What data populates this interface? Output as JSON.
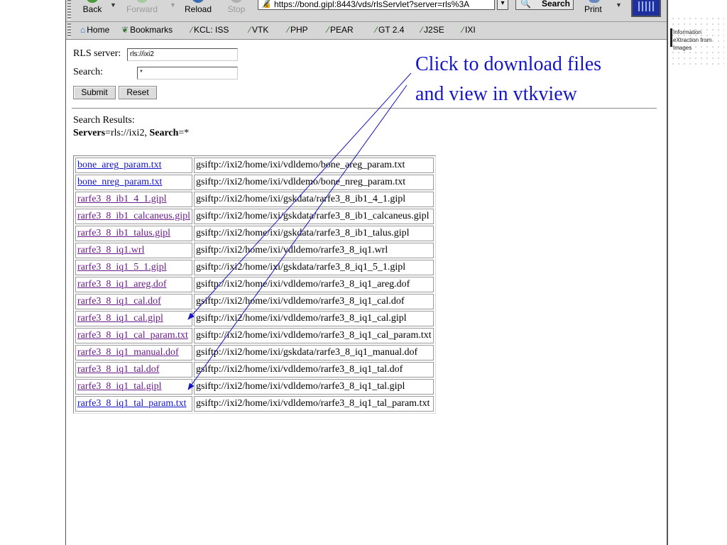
{
  "toolbar": {
    "back": "Back",
    "forward": "Forward",
    "reload": "Reload",
    "stop": "Stop",
    "url": "https://bond.gipl:8443/vds/rlsServlet?server=rls%3A",
    "search": "Search",
    "print": "Print"
  },
  "personal_toolbar": {
    "items": [
      "Home",
      "Bookmarks",
      "KCL: ISS",
      "VTK",
      "PHP",
      "PEAR",
      "GT 2.4",
      "J2SE",
      "IXI"
    ]
  },
  "form": {
    "server_label": "RLS server:",
    "server_value": "rls://ixi2",
    "search_label": "Search:",
    "search_value": "*",
    "submit": "Submit",
    "reset": "Reset"
  },
  "results": {
    "heading": "Search Results:",
    "servers_key": "Servers",
    "servers_value": "=rls://ixi2, ",
    "search_key": "Search",
    "search_value": "=*",
    "rows": [
      {
        "name": "bone_areg_param.txt",
        "path": "gsiftp://ixi2/home/ixi/vdldemo/bone_areg_param.txt",
        "visited": false
      },
      {
        "name": "bone_nreg_param.txt",
        "path": "gsiftp://ixi2/home/ixi/vdldemo/bone_nreg_param.txt",
        "visited": false
      },
      {
        "name": "rarfe3_8_ib1_4_1.gipl",
        "path": "gsiftp://ixi2/home/ixi/gskdata/rarfe3_8_ib1_4_1.gipl",
        "visited": true
      },
      {
        "name": "rarfe3_8_ib1_calcaneus.gipl",
        "path": "gsiftp://ixi2/home/ixi/gskdata/rarfe3_8_ib1_calcaneus.gipl",
        "visited": true
      },
      {
        "name": "rarfe3_8_ib1_talus.gipl",
        "path": "gsiftp://ixi2/home/ixi/gskdata/rarfe3_8_ib1_talus.gipl",
        "visited": true
      },
      {
        "name": "rarfe3_8_iq1.wrl",
        "path": "gsiftp://ixi2/home/ixi/vdldemo/rarfe3_8_iq1.wrl",
        "visited": true
      },
      {
        "name": "rarfe3_8_iq1_5_1.gipl",
        "path": "gsiftp://ixi2/home/ixi/gskdata/rarfe3_8_iq1_5_1.gipl",
        "visited": true
      },
      {
        "name": "rarfe3_8_iq1_areg.dof",
        "path": "gsiftp://ixi2/home/ixi/vdldemo/rarfe3_8_iq1_areg.dof",
        "visited": true
      },
      {
        "name": "rarfe3_8_iq1_cal.dof",
        "path": "gsiftp://ixi2/home/ixi/vdldemo/rarfe3_8_iq1_cal.dof",
        "visited": true
      },
      {
        "name": "rarfe3_8_iq1_cal.gipl",
        "path": "gsiftp://ixi2/home/ixi/vdldemo/rarfe3_8_iq1_cal.gipl",
        "visited": true
      },
      {
        "name": "rarfe3_8_iq1_cal_param.txt",
        "path": "gsiftp://ixi2/home/ixi/vdldemo/rarfe3_8_iq1_cal_param.txt",
        "visited": true
      },
      {
        "name": "rarfe3_8_iq1_manual.dof",
        "path": "gsiftp://ixi2/home/ixi/gskdata/rarfe3_8_iq1_manual.dof",
        "visited": true
      },
      {
        "name": "rarfe3_8_iq1_tal.dof",
        "path": "gsiftp://ixi2/home/ixi/vdldemo/rarfe3_8_iq1_tal.dof",
        "visited": true
      },
      {
        "name": "rarfe3_8_iq1_tal.gipl",
        "path": "gsiftp://ixi2/home/ixi/vdldemo/rarfe3_8_iq1_tal.gipl",
        "visited": true
      },
      {
        "name": "rarfe3_8_iq1_tal_param.txt",
        "path": "gsiftp://ixi2/home/ixi/vdldemo/rarfe3_8_iq1_tal_param.txt",
        "visited": false
      }
    ]
  },
  "annotation": {
    "line1": "Click to download files",
    "line2": "and view in vtkview"
  },
  "watermark": {
    "line1": "Information",
    "line2": "eXtraction  from",
    "line3": "Images"
  },
  "colors": {
    "annotation": "#1515c8",
    "link": "#1414c8",
    "visited_link": "#6a1c8a",
    "toolbar_bg": "#d6d6d6"
  }
}
